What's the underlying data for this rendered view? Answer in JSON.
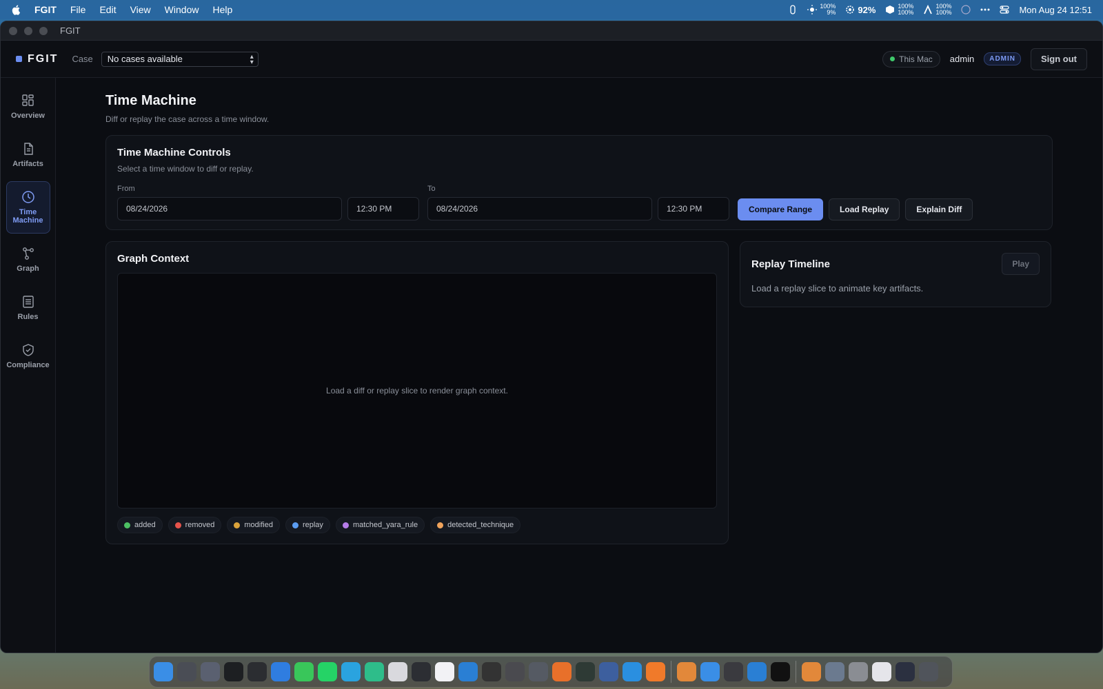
{
  "menubar": {
    "app_name": "FGIT",
    "menus": [
      "File",
      "Edit",
      "View",
      "Window",
      "Help"
    ],
    "status_a_top": "100%",
    "status_a_bottom": "9%",
    "battery": "92%",
    "status_b_top": "100%",
    "status_b_bottom": "100%",
    "status_c_top": "100%",
    "status_c_bottom": "100%",
    "datetime": "Mon Aug 24  12:51"
  },
  "window": {
    "title": "FGIT"
  },
  "header": {
    "brand": "FGIT",
    "case_label": "Case",
    "case_select_value": "No cases available",
    "host": "This Mac",
    "user": "admin",
    "role": "ADMIN",
    "signout_label": "Sign out"
  },
  "sidebar": {
    "items": [
      {
        "label": "Overview",
        "icon": "grid-icon"
      },
      {
        "label": "Artifacts",
        "icon": "document-icon"
      },
      {
        "label": "Time Machine",
        "icon": "clock-icon",
        "active": true
      },
      {
        "label": "Graph",
        "icon": "graph-icon"
      },
      {
        "label": "Rules",
        "icon": "list-icon"
      },
      {
        "label": "Compliance",
        "icon": "shield-check-icon"
      }
    ]
  },
  "page": {
    "title": "Time Machine",
    "subtitle": "Diff or replay the case across a time window."
  },
  "controls": {
    "title": "Time Machine Controls",
    "subtitle": "Select a time window to diff or replay.",
    "from_label": "From",
    "from_date": "08/24/2026",
    "from_time": "12:30 PM",
    "to_label": "To",
    "to_date": "08/24/2026",
    "to_time": "12:30 PM",
    "compare_label": "Compare Range",
    "load_label": "Load Replay",
    "explain_label": "Explain Diff",
    "accent": "#6b8df0"
  },
  "graph": {
    "title": "Graph Context",
    "empty_text": "Load a diff or replay slice to render graph context.",
    "legend": [
      {
        "label": "added",
        "color": "#4cbf63"
      },
      {
        "label": "removed",
        "color": "#e5534b"
      },
      {
        "label": "modified",
        "color": "#d9a23a"
      },
      {
        "label": "replay",
        "color": "#5b9cf0"
      },
      {
        "label": "matched_yara_rule",
        "color": "#b57ce8"
      },
      {
        "label": "detected_technique",
        "color": "#f0a35b"
      }
    ]
  },
  "replay": {
    "title": "Replay Timeline",
    "play_label": "Play",
    "text": "Load a replay slice to animate key artifacts."
  }
}
